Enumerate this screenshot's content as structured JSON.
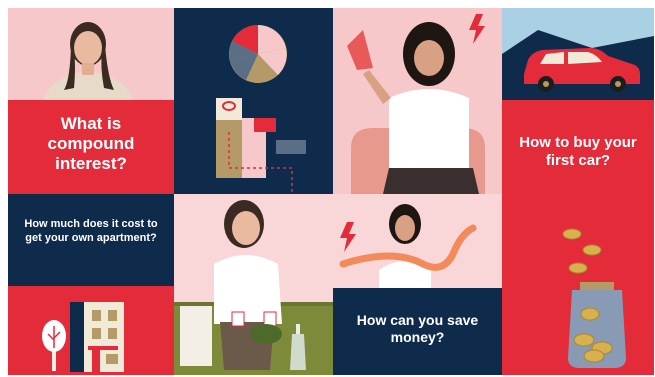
{
  "tiles": {
    "compound_interest": {
      "text": "What is compound interest?"
    },
    "apartment_cost": {
      "text": "How much does it cost to get your own apartment?"
    },
    "save_money": {
      "text": "How can you save money?"
    },
    "buy_car": {
      "text": "How to buy your first car?"
    }
  },
  "icons": {
    "pie_chart": "pie-chart-icon",
    "bar_chart": "bar-chart-icon",
    "lightning": "lightning-icon",
    "car": "car-icon",
    "coin_jar": "coin-jar-icon",
    "house": "house-icon",
    "tree": "tree-icon"
  },
  "colors": {
    "red": "#e32b3a",
    "navy": "#0f2b4c",
    "pink": "#f7c8c9",
    "gold": "#b49a67",
    "light_blue": "#a9d0e3"
  }
}
